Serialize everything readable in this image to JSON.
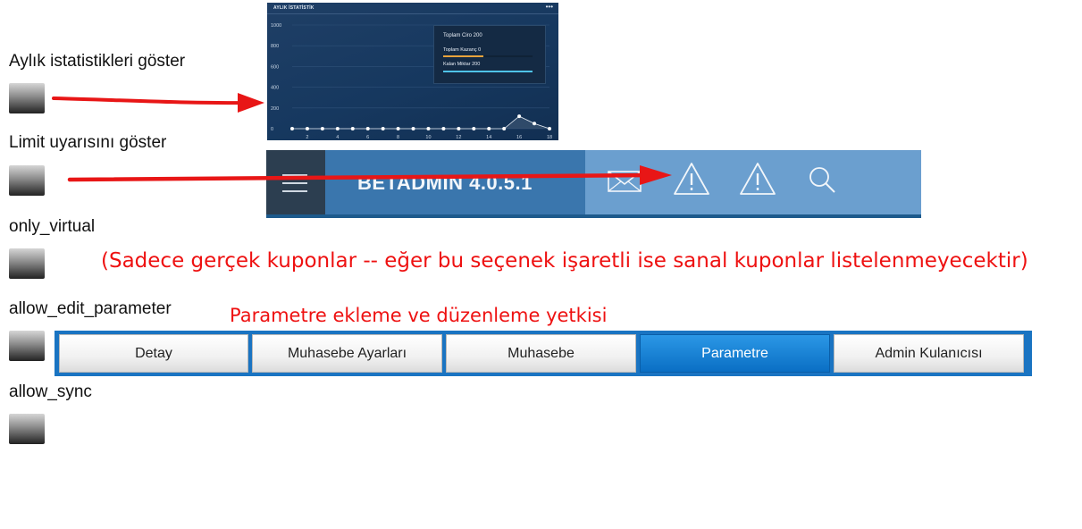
{
  "settings": [
    {
      "label": "Aylık istatistikleri göster"
    },
    {
      "label": "Limit uyarısını göster"
    },
    {
      "label": "only_virtual"
    },
    {
      "label": "allow_edit_parameter"
    },
    {
      "label": "allow_sync"
    }
  ],
  "notes": {
    "only_virtual": "(Sadece gerçek kuponlar -- eğer bu seçenek işaretli ise sanal kuponlar listelenmeyecektir)",
    "allow_edit_parameter": "Parametre ekleme ve düzenleme yetkisi"
  },
  "stats_panel": {
    "title": "AYLIK İSTATİSTİK",
    "menu": "•••",
    "tooltip": {
      "ciro": "Toplam Ciro 200",
      "kazanc": "Toplam Kazanç 0",
      "miktar": "Kalan Miktar 200",
      "kazanc_color": "#e8a33c",
      "miktar_color": "#4fc3e8"
    }
  },
  "chart_data": {
    "type": "line",
    "x": [
      1,
      2,
      3,
      4,
      5,
      6,
      7,
      8,
      9,
      10,
      11,
      12,
      13,
      14,
      15,
      16,
      17,
      18
    ],
    "x_ticks": [
      "2",
      "4",
      "6",
      "8",
      "10",
      "12",
      "14",
      "16",
      "18"
    ],
    "y_ticks": [
      "0",
      "200",
      "400",
      "600",
      "800",
      "1000"
    ],
    "ylim": [
      0,
      1000
    ],
    "series": [
      {
        "values": [
          0,
          0,
          0,
          0,
          0,
          0,
          0,
          0,
          0,
          0,
          0,
          0,
          0,
          0,
          0,
          120,
          50,
          0
        ],
        "color": "#ffffff"
      }
    ]
  },
  "header": {
    "brand": "BETADMIN 4.0.5.1",
    "icons": [
      "menu-icon",
      "mail-icon",
      "warning-icon",
      "warning-icon",
      "search-icon"
    ]
  },
  "tabs": [
    {
      "label": "Detay",
      "active": false
    },
    {
      "label": "Muhasebe Ayarları",
      "active": false
    },
    {
      "label": "Muhasebe",
      "active": false
    },
    {
      "label": "Parametre",
      "active": true
    },
    {
      "label": "Admin Kulanıcısı",
      "active": false
    }
  ],
  "colors": {
    "annotation": "#ee1111",
    "tab_active": "#0a6fc4"
  }
}
